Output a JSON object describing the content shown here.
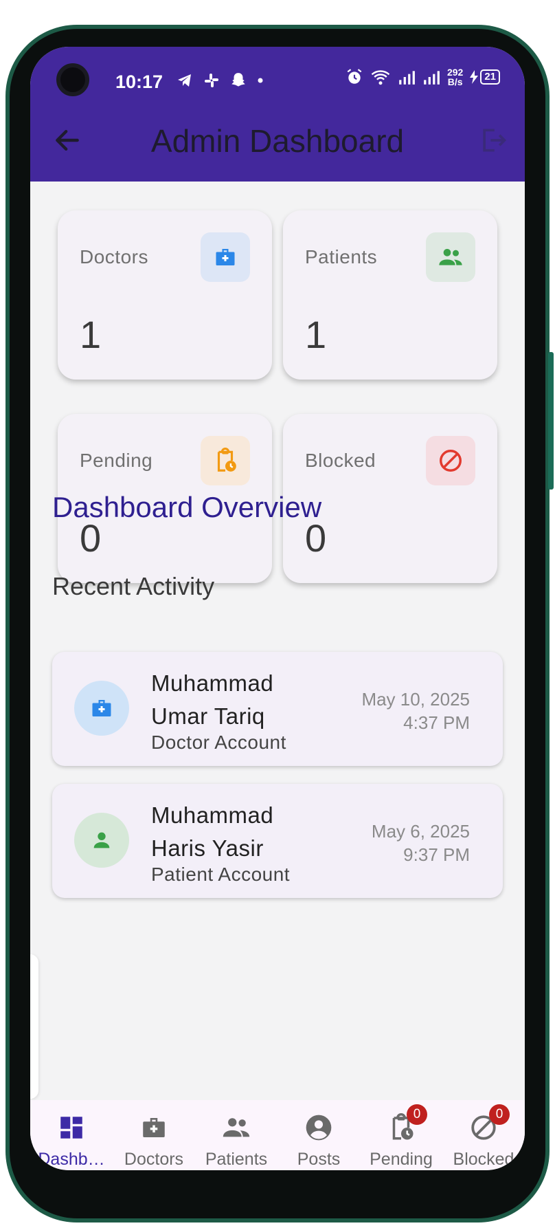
{
  "status_bar": {
    "time": "10:17",
    "net_speed_value": "292",
    "net_speed_unit": "B/s",
    "battery": "21"
  },
  "app_bar": {
    "title": "Admin Dashboard"
  },
  "stats": [
    {
      "label": "Doctors",
      "value": "1",
      "icon": "medical-bag-icon",
      "icon_color": "#2b87e8",
      "icon_bg": "#dde6f6"
    },
    {
      "label": "Patients",
      "value": "1",
      "icon": "people-icon",
      "icon_color": "#3aa148",
      "icon_bg": "#dfe9e2"
    },
    {
      "label": "Pending",
      "value": "0",
      "icon": "pending-clipboard-icon",
      "icon_color": "#f29a12",
      "icon_bg": "#f8e9db"
    },
    {
      "label": "Blocked",
      "value": "0",
      "icon": "block-icon",
      "icon_color": "#e23a2e",
      "icon_bg": "#f5dde2"
    }
  ],
  "section_title": "Dashboard Overview",
  "recent_title": "Recent Activity",
  "activities": [
    {
      "name": "Muhammad Umar Tariq",
      "type": "Doctor Account",
      "date": "May 10, 2025",
      "time": "4:37 PM",
      "avatar_bg": "#cfe3f8",
      "avatar_color": "#2b87e8"
    },
    {
      "name": "Muhammad Haris Yasir",
      "type": "Patient Account",
      "date": "May 6, 2025",
      "time": "9:37 PM",
      "avatar_bg": "#d6e8d8",
      "avatar_color": "#3aa148"
    }
  ],
  "bottom_nav": [
    {
      "label": "Dashb…",
      "icon": "dashboard-icon",
      "active": true
    },
    {
      "label": "Doctors",
      "icon": "medical-bag-icon"
    },
    {
      "label": "Patients",
      "icon": "people-icon"
    },
    {
      "label": "Posts",
      "icon": "account-circle-icon"
    },
    {
      "label": "Pending",
      "icon": "pending-clipboard-icon",
      "badge": "0"
    },
    {
      "label": "Blocked",
      "icon": "block-icon",
      "badge": "0"
    }
  ],
  "colors": {
    "primary": "#43289c",
    "section_title": "#2f2090",
    "badge": "#c0201f"
  }
}
